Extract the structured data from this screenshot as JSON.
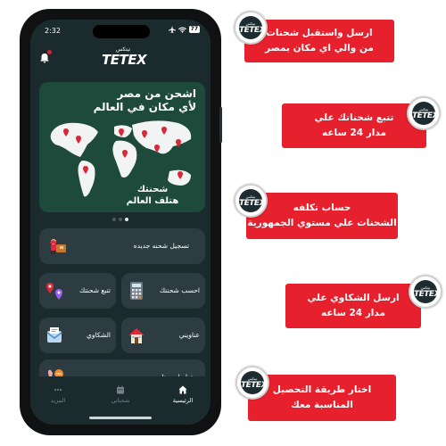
{
  "status_bar": {
    "time": "2:32",
    "battery": "77"
  },
  "app": {
    "logo_ar": "تيتكس",
    "logo_en": "TETEX"
  },
  "banner": {
    "title_line1": "اشحن من مصر",
    "title_line2": "لأي مكان في العالم",
    "sub_line1": "شحنتك",
    "sub_line2": "هتلف العالم",
    "active_slide": 3,
    "slide_count": 3
  },
  "cards": {
    "new_shipment": "تسجيل شحنه جديده",
    "calc_shipment": "احسب شحنتك",
    "track_shipment": "تتبع شحنتك",
    "addresses": "عناويني",
    "complaints": "الشكاوي",
    "contact_us": "تواصل معنا"
  },
  "nav": {
    "home": "الرئيسية",
    "shipments": "شحناتي",
    "more": "المزيد"
  },
  "badge": {
    "ar": "تيتكس",
    "en": "TETEX"
  },
  "callouts": [
    {
      "line1": "ارسل واستقبل شحنات",
      "line2": "من والي اي مكان بمصر"
    },
    {
      "line1": "تتبع شحناتك علي",
      "line2": "مدار 24 ساعه"
    },
    {
      "line1": "حساب تكلفه",
      "line2": "الشحنات علي مستوي الجمهورية"
    },
    {
      "line1": "ارسل الشكاوي علي",
      "line2": "مدار 24 ساعه"
    },
    {
      "line1": "اختار طريقة التحصيل",
      "line2": "المناسبة معك"
    }
  ],
  "colors": {
    "accent_red": "#e6202d",
    "screen_bg": "#1b2a2d",
    "card_bg": "#2c3c40",
    "banner_green": "#1e4a3c"
  }
}
